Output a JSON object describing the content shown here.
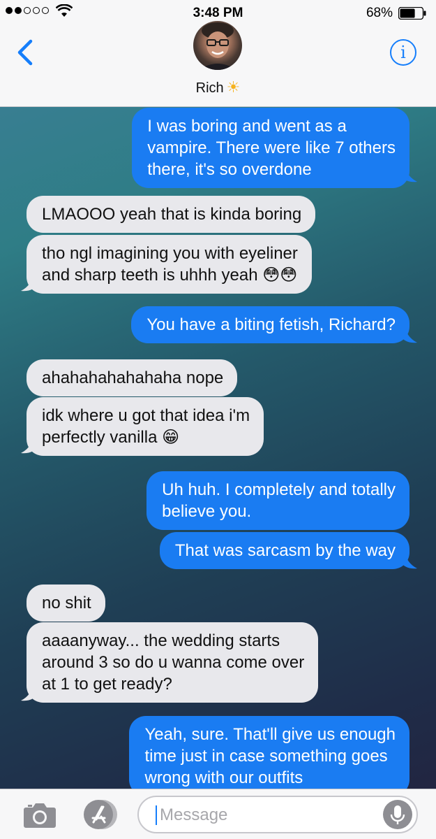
{
  "status_bar": {
    "time": "3:48 PM",
    "battery_percent": "68%",
    "signal_strength": 2,
    "signal_total": 5,
    "battery_level": 0.68
  },
  "header": {
    "contact_name": "Rich",
    "contact_emoji": "☀",
    "back_icon": "chevron-left-icon",
    "info_icon": "info-icon",
    "info_glyph": "i"
  },
  "messages": [
    {
      "direction": "sent",
      "text": "I was boring and went as a\nvampire. There were like 7 others\nthere, it's so overdone"
    },
    {
      "direction": "received",
      "text": "LMAOOO yeah that is kinda boring"
    },
    {
      "direction": "received",
      "text": "tho ngl imagining you with eyeliner\nand sharp teeth is uhhh yeah 😳😳"
    },
    {
      "direction": "sent",
      "text": "You have a biting fetish, Richard?"
    },
    {
      "direction": "received",
      "text": "ahahahahahahaha nope"
    },
    {
      "direction": "received",
      "text": "idk where u got that idea i'm\nperfectly vanilla 😁"
    },
    {
      "direction": "sent",
      "text": "Uh huh. I completely and totally\nbelieve you."
    },
    {
      "direction": "sent",
      "text": "That was sarcasm by the way"
    },
    {
      "direction": "received",
      "text": "no shit"
    },
    {
      "direction": "received",
      "text": "aaaanyway... the wedding starts\naround 3 so do u wanna come over\nat 1 to get ready?"
    },
    {
      "direction": "sent",
      "text": "Yeah, sure. That'll give us enough\ntime just in case something goes\nwrong with our outfits"
    }
  ],
  "composer": {
    "placeholder": "Message",
    "camera_icon": "camera-icon",
    "appstore_icon": "app-store-icon",
    "mic_icon": "microphone-icon"
  },
  "colors": {
    "sent_bubble": "#1a7cf2",
    "received_bubble": "#e8e8ec",
    "accent": "#157efb"
  }
}
